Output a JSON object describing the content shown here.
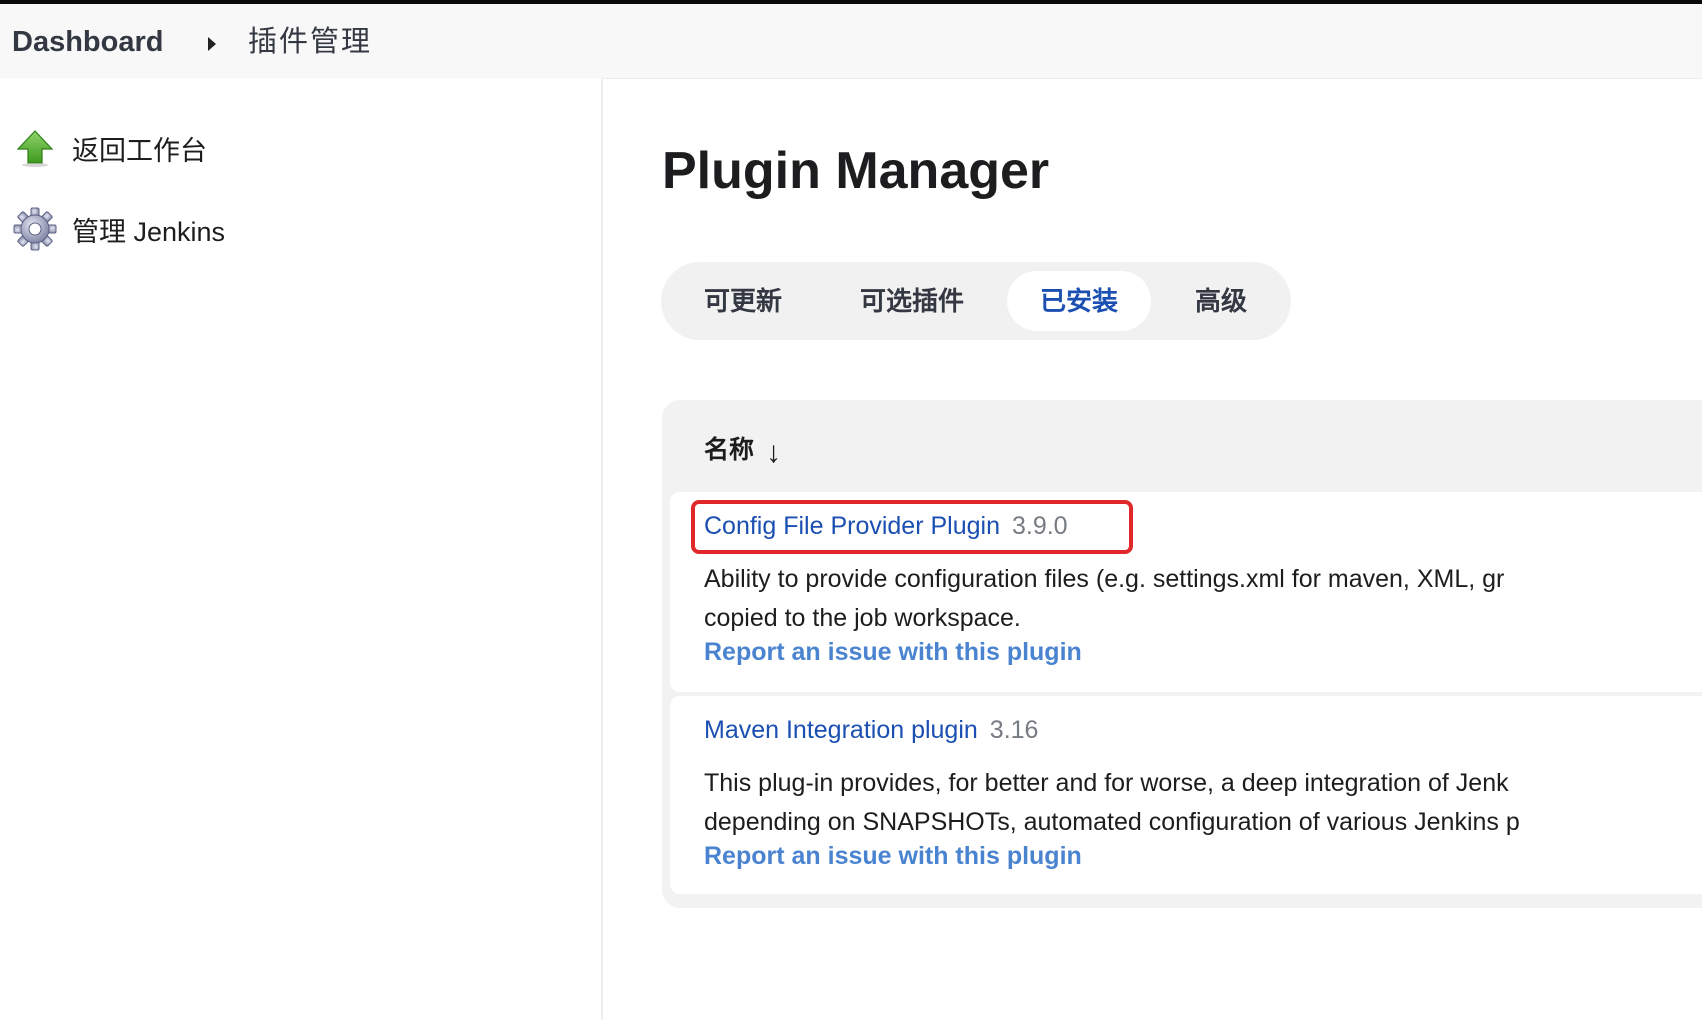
{
  "breadcrumb": {
    "home": "Dashboard",
    "current": "插件管理"
  },
  "sidebar": {
    "items": [
      {
        "label": "返回工作台",
        "icon": "up-arrow-icon"
      },
      {
        "label": "管理 Jenkins",
        "icon": "gear-icon"
      }
    ]
  },
  "main": {
    "title": "Plugin Manager",
    "tabs": [
      {
        "label": "可更新",
        "active": false
      },
      {
        "label": "可选插件",
        "active": false
      },
      {
        "label": "已安装",
        "active": true
      },
      {
        "label": "高级",
        "active": false
      }
    ],
    "table": {
      "column_header": "名称",
      "sort_indicator": "↓",
      "plugins": [
        {
          "name": "Config File Provider Plugin",
          "version": "3.9.0",
          "description_lines": [
            "Ability to provide configuration files (e.g. settings.xml for maven, XML, gr",
            "copied to the job workspace."
          ],
          "report_link": "Report an issue with this plugin"
        },
        {
          "name": "Maven Integration plugin",
          "version": "3.16",
          "description_lines": [
            "This plug-in provides, for better and for worse, a deep integration of Jenk",
            "depending on SNAPSHOTs, automated configuration of various Jenkins p"
          ],
          "report_link": "Report an issue with this plugin"
        }
      ]
    }
  },
  "colors": {
    "link": "#1b4fb2",
    "report_link": "#4a83d0",
    "highlight": "#e0282b",
    "active_tab_text": "#1b4fb2"
  }
}
